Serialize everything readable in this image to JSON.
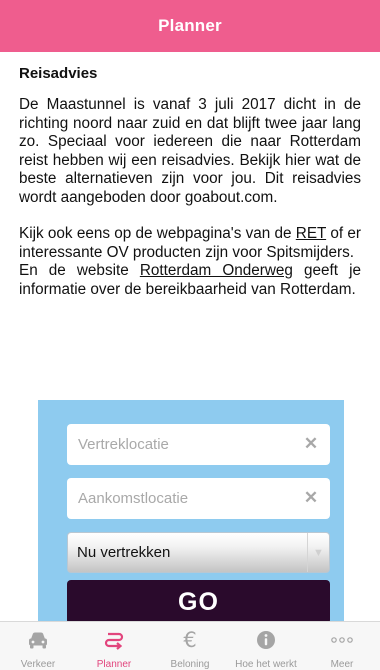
{
  "header": {
    "title": "Planner"
  },
  "content": {
    "heading": "Reisadvies",
    "paragraph1": "De Maastunnel is vanaf 3 juli 2017 dicht in de richting noord naar zuid en dat blijft twee jaar lang zo. Speciaal voor iedereen die naar Rotterdam reist hebben wij een reisadvies. Bekijk hier wat de beste alternatieven zijn voor jou. Dit reisadvies wordt aangeboden door goabout.com.",
    "paragraph2_pre": "Kijk ook eens op de webpagina's van de ",
    "paragraph2_link": "RET",
    "paragraph2_post": " of er interessante OV producten zijn voor Spitsmijders.",
    "paragraph3_pre": "En de website ",
    "paragraph3_link": "Rotterdam Onderweg",
    "paragraph3_post": " geeft je informatie over de bereikbaarheid van Rotterdam."
  },
  "planner": {
    "from_placeholder": "Vertreklocatie",
    "to_placeholder": "Aankomstlocatie",
    "departure_option": "Nu vertrekken",
    "go_label": "GO"
  },
  "colors": {
    "brand_pink": "#ef5d8e",
    "panel_blue": "#8ecbef",
    "go_dark": "#2a0a2c",
    "tab_active": "#e2457d",
    "tab_inactive": "#9a9a9a"
  },
  "tabbar": {
    "items": [
      {
        "label": "Verkeer",
        "icon": "car-icon",
        "active": false
      },
      {
        "label": "Planner",
        "icon": "route-arrows-icon",
        "active": true
      },
      {
        "label": "Beloning",
        "icon": "euro-icon",
        "active": false
      },
      {
        "label": "Hoe het werkt",
        "icon": "info-icon",
        "active": false
      },
      {
        "label": "Meer",
        "icon": "more-dots-icon",
        "active": false
      }
    ]
  }
}
